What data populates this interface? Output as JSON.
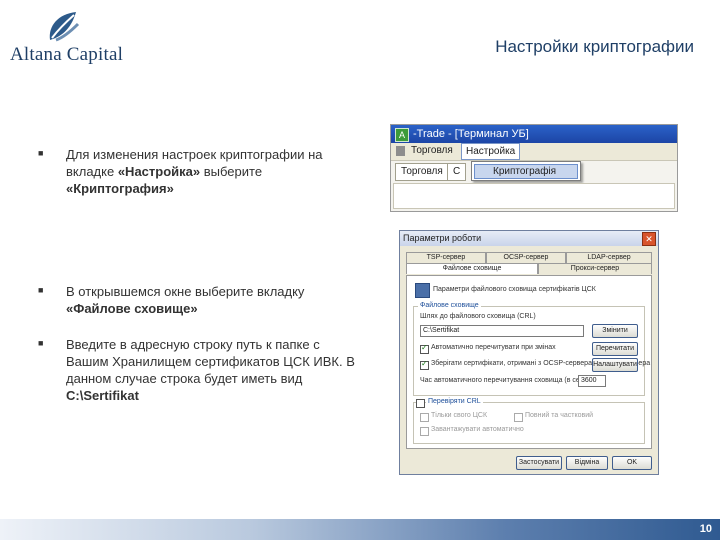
{
  "header": {
    "logo_text": "Altana Capital",
    "title": "Настройки криптографии"
  },
  "bullets": [
    {
      "pre": "Для изменения настроек криптографии на вкладке ",
      "b1": "«Настройка»",
      "mid": " выберите ",
      "b2": "«Криптография»"
    },
    {
      "pre": "В открывшемся окне выберите вкладку ",
      "b1": "«Файлове сховище»"
    },
    {
      "pre": "Введите в адресную строку путь к папке с Вашим Хранилищем сертификатов ЦСК ИВК. В данном случае строка будет иметь вид ",
      "b1": "C:\\Sertifikat"
    }
  ],
  "screenshot1": {
    "window_title": "-Trade - [Терминал УБ]",
    "menu_items": [
      "Торговля",
      "Настройка"
    ],
    "tabs": [
      "Торговля",
      "С"
    ],
    "dropdown_item": "Криптографія"
  },
  "screenshot2": {
    "dialog_title": "Параметри роботи",
    "tabs_row1": [
      "TSP-сервер",
      "OCSP-сервер",
      "LDAP-сервер"
    ],
    "tabs_row2": [
      "Файлове сховище",
      "Прокси-сервер"
    ],
    "panel_header": "Параметри файлового сховища сертифікатів ЦСК",
    "group_label": "Файлове сховище",
    "path_label": "Шлях до файлового сховища (CRL)",
    "path_value": "C:\\Sertifikat",
    "change_button": "Змінити",
    "check1": "Автоматично перечитувати при змінах",
    "check1_button": "Перечитати",
    "check2": "Зберігати сертифікати, отримані з OCSP-сервера та LDAP-сервера",
    "check2_button": "Налаштувати",
    "interval_label": "Час автоматичного перечитування сховища (в сек.)",
    "interval_value": "3600",
    "crl_group": "Перевіряти CRL",
    "crl_check1": "Тільки свого ЦСК",
    "crl_check2": "Повний та частковий",
    "crl_check3": "Завантажувати автоматично",
    "buttons": [
      "Застосувати",
      "Відміна",
      "OK"
    ]
  },
  "footer": {
    "page_number": "10"
  },
  "colors": {
    "brand_blue": "#1f3f66",
    "footer_dark": "#2f5a91",
    "titlebar_blue": "#2b62c8"
  }
}
